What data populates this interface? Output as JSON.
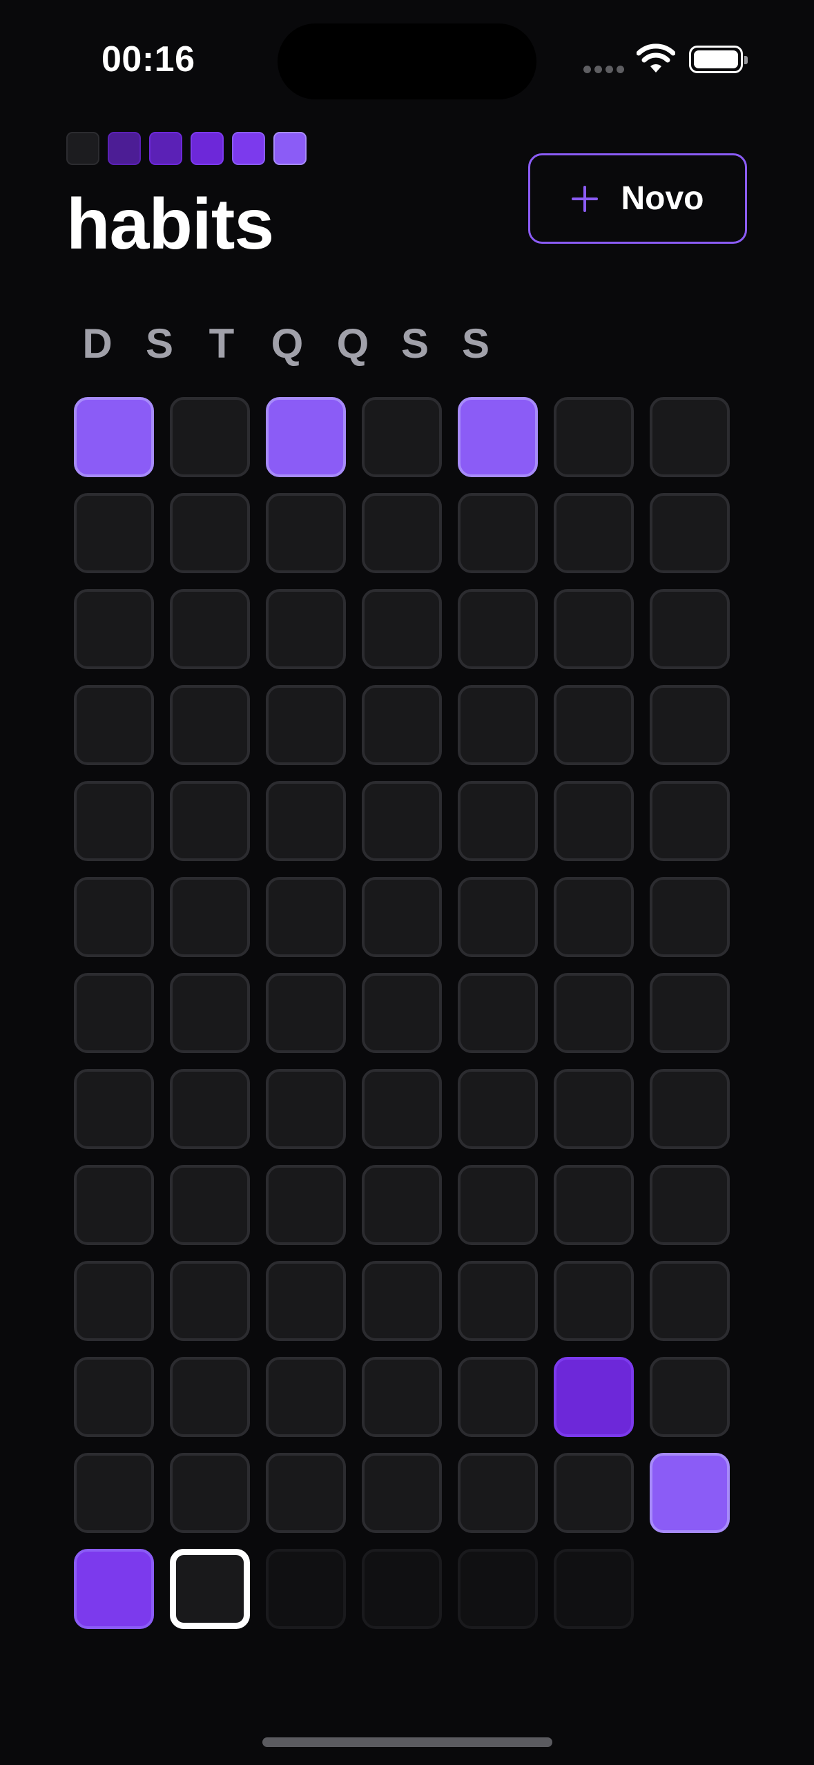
{
  "status_bar": {
    "time": "00:16"
  },
  "header": {
    "title": "habits",
    "new_button_label": "Novo",
    "legend_colors": [
      "#1c1c1f",
      "#4c1d95",
      "#5b21b6",
      "#6d28d9",
      "#7c3aed",
      "#8b5cf6"
    ]
  },
  "weekdays": [
    "D",
    "S",
    "T",
    "Q",
    "Q",
    "S",
    "S"
  ],
  "calendar": {
    "rows": [
      [
        5,
        0,
        5,
        0,
        5,
        0,
        0
      ],
      [
        0,
        0,
        0,
        0,
        0,
        0,
        0
      ],
      [
        0,
        0,
        0,
        0,
        0,
        0,
        0
      ],
      [
        0,
        0,
        0,
        0,
        0,
        0,
        0
      ],
      [
        0,
        0,
        0,
        0,
        0,
        0,
        0
      ],
      [
        0,
        0,
        0,
        0,
        0,
        0,
        0
      ],
      [
        0,
        0,
        0,
        0,
        0,
        0,
        0
      ],
      [
        0,
        0,
        0,
        0,
        0,
        0,
        0
      ],
      [
        0,
        0,
        0,
        0,
        0,
        0,
        0
      ],
      [
        0,
        0,
        0,
        0,
        0,
        0,
        0
      ],
      [
        0,
        0,
        0,
        0,
        0,
        3,
        0
      ],
      [
        0,
        0,
        0,
        0,
        0,
        0,
        5
      ],
      [
        4,
        "today",
        "future",
        "future",
        "future",
        "future",
        null
      ]
    ]
  }
}
